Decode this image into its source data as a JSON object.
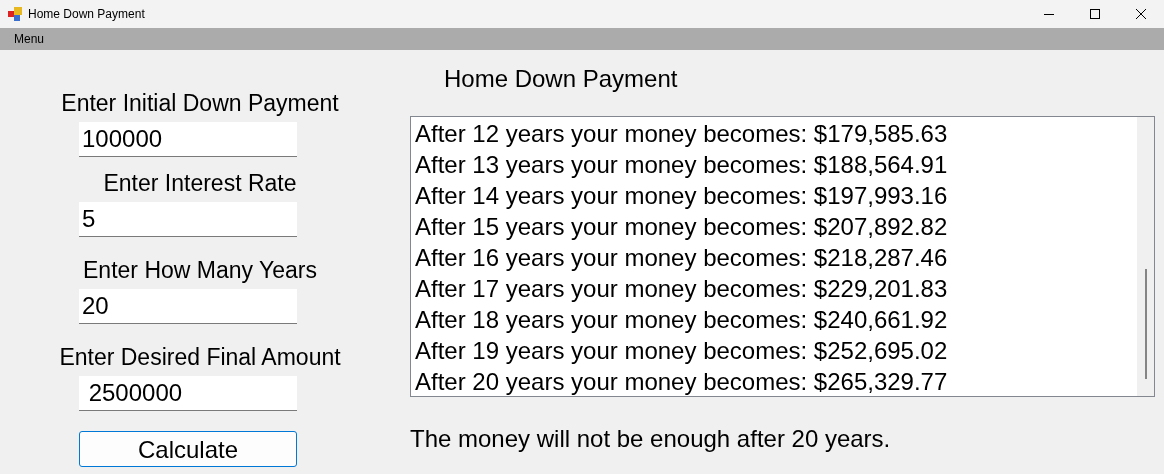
{
  "window": {
    "title": "Home Down Payment"
  },
  "menu": [
    "Menu"
  ],
  "form": {
    "fields": [
      {
        "label": "Enter Initial Down Payment",
        "value": "100000"
      },
      {
        "label": "Enter Interest Rate",
        "value": "5"
      },
      {
        "label": "Enter How Many Years",
        "value": "20"
      },
      {
        "label": "Enter Desired Final Amount",
        "value": " 2500000"
      }
    ],
    "button": "Calculate"
  },
  "results": {
    "heading": "Home Down Payment",
    "lines": [
      "After 12 years your money becomes: $179,585.63",
      "After 13 years your money becomes: $188,564.91",
      "After 14 years your money becomes: $197,993.16",
      "After 15 years your money becomes: $207,892.82",
      "After 16 years your money becomes: $218,287.46",
      "After 17 years your money becomes: $229,201.83",
      "After 18 years your money becomes: $240,661.92",
      "After 19 years your money becomes: $252,695.02",
      "After 20 years your money becomes: $265,329.77"
    ],
    "message": "The money will not be enough after 20 years."
  }
}
